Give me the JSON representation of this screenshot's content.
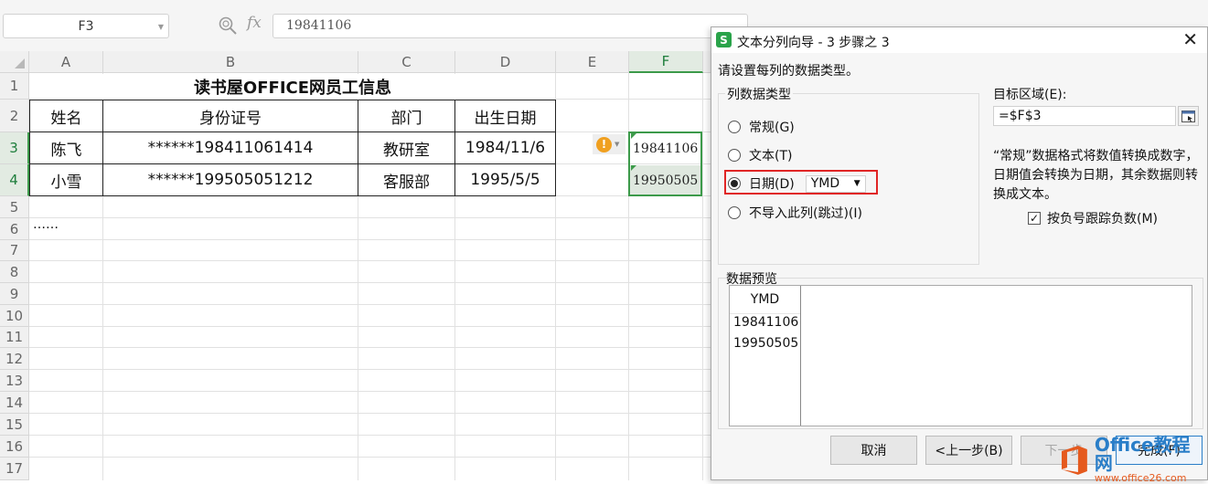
{
  "formula_bar": {
    "name_box": "F3",
    "fx": "fx",
    "formula": "19841106"
  },
  "sheet": {
    "columns": [
      "A",
      "B",
      "C",
      "D",
      "E",
      "F"
    ],
    "selected_column": "F",
    "rows": [
      "1",
      "2",
      "3",
      "4",
      "5",
      "6",
      "7",
      "8",
      "9",
      "10",
      "11",
      "12",
      "13",
      "14",
      "15",
      "16",
      "17"
    ],
    "title": "读书屋OFFICE网员工信息",
    "headers": [
      "姓名",
      "身份证号",
      "部门",
      "出生日期"
    ],
    "records": [
      [
        "陈飞",
        "******198411061414",
        "教研室",
        "1984/11/6"
      ],
      [
        "小雪",
        "******199505051212",
        "客服部",
        "1995/5/5"
      ]
    ],
    "ellipsis": "……",
    "f_values": [
      "19841106",
      "19950505"
    ]
  },
  "dialog": {
    "title": "文本分列向导 - 3 步骤之 3",
    "instruction": "请设置每列的数据类型。",
    "group_label": "列数据类型",
    "options": [
      "常规(G)",
      "文本(T)",
      "日期(D)",
      "不导入此列(跳过)(I)"
    ],
    "selected_option": "日期(D)",
    "date_format": "YMD",
    "dest_label": "目标区域(E):",
    "dest_value": "=$F$3",
    "info": "“常规”数据格式将数值转换成数字，日期值会转换为日期，其余数据则转换成文本。",
    "negative_label": "按负号跟踪负数(M)",
    "negative_checked": true,
    "preview_label": "数据预览",
    "preview_header": "YMD",
    "preview_rows": [
      "19841106",
      "19950505"
    ],
    "buttons": {
      "cancel": "取消",
      "back": "<上一步(B)",
      "next": "下一步",
      "finish": "完成(F)"
    }
  },
  "watermark": {
    "brand": "Office教程网",
    "url": "www.office26.com"
  },
  "colors": {
    "selection_green": "#3c9a4a",
    "highlight_red": "#e02525",
    "warning_orange": "#f0a020",
    "app_icon_green": "#2aa34a",
    "watermark_blue": "#2a7ec8",
    "watermark_orange": "#e55a1e"
  },
  "icons": [
    "zoom-icon",
    "fx-icon",
    "warning-icon",
    "app-icon",
    "close-icon",
    "range-select-icon",
    "checkbox-check-icon",
    "office-logo-icon"
  ]
}
